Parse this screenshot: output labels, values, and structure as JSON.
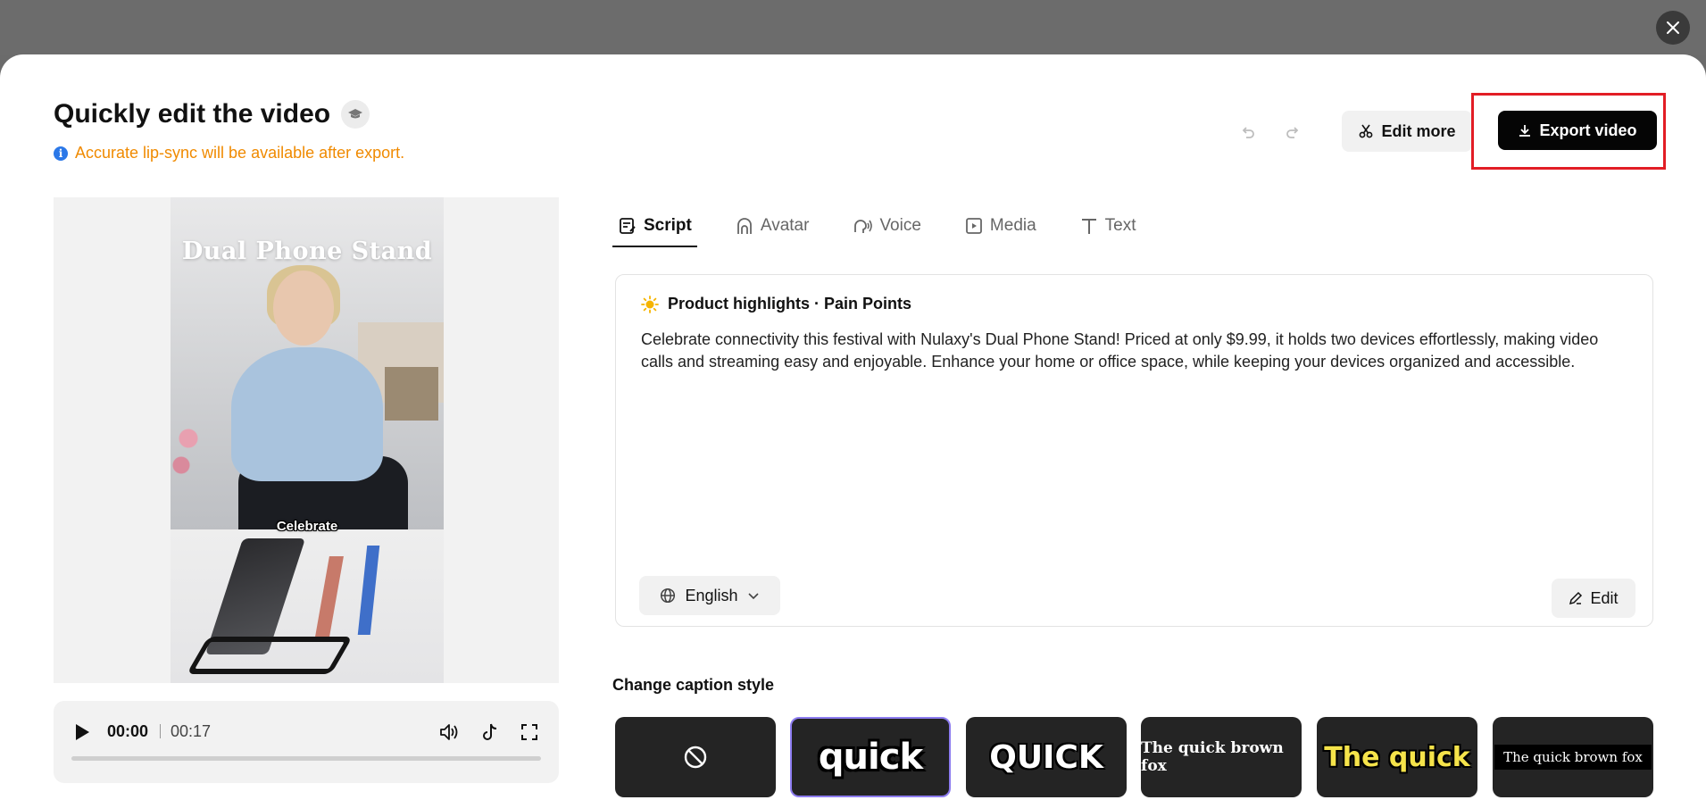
{
  "modal": {
    "title": "Quickly edit the video",
    "notice": "Accurate lip-sync will be available after export.",
    "info_glyph": "i"
  },
  "toolbar": {
    "edit_more_label": "Edit more",
    "export_label": "Export video"
  },
  "preview": {
    "video_title": "Dual Phone Stand",
    "caption_text": "Celebrate",
    "current_time": "00:00",
    "total_time": "00:17",
    "progress": 0
  },
  "tabs": [
    {
      "label": "Script",
      "icon": "script-icon",
      "active": true
    },
    {
      "label": "Avatar",
      "icon": "avatar-icon",
      "active": false
    },
    {
      "label": "Voice",
      "icon": "voice-icon",
      "active": false
    },
    {
      "label": "Media",
      "icon": "media-icon",
      "active": false
    },
    {
      "label": "Text",
      "icon": "text-icon",
      "active": false
    }
  ],
  "script": {
    "heading": "Product highlights · Pain Points",
    "body": "Celebrate connectivity this festival with Nulaxy's Dual Phone Stand! Priced at only $9.99, it holds two devices effortlessly, making video calls and streaming easy and enjoyable. Enhance your home or office space, while keeping your devices organized and accessible.",
    "language": "English",
    "edit_label": "Edit"
  },
  "captions": {
    "label": "Change caption style",
    "styles": [
      {
        "sample": "",
        "icon": "no-caption-icon"
      },
      {
        "sample": "quick",
        "selected": true
      },
      {
        "sample": "QUICK"
      },
      {
        "sample": "The quick brown fox"
      },
      {
        "sample": "The quick"
      },
      {
        "sample": "The quick brown fox"
      }
    ]
  },
  "colors": {
    "accent_orange": "#f08a00",
    "export_bg": "#050505",
    "highlight_red": "#e21d25",
    "selected_border": "#8d7cf0",
    "info_blue": "#2b78e8"
  }
}
